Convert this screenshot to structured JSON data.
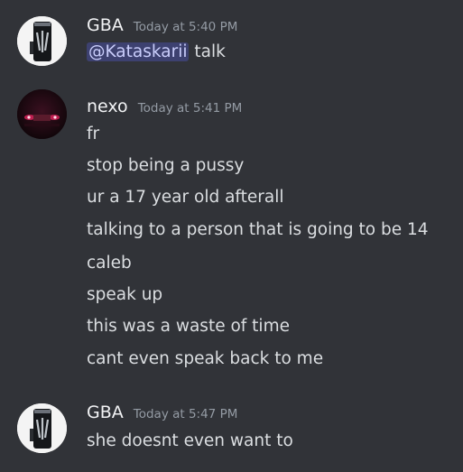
{
  "colors": {
    "background": "#313338",
    "username": "#f2f3f5",
    "timestamp": "#949ba4",
    "text": "#dbdee1",
    "mention_bg": "#3c4270",
    "mention_text": "#c9cdfb"
  },
  "messages": [
    {
      "username": "GBA",
      "timestamp": "Today at 5:40 PM",
      "avatar_icon": "monster-energy-can-icon",
      "mention": "@Kataskarii",
      "lines": [
        "talk"
      ]
    },
    {
      "username": "nexo",
      "timestamp": "Today at 5:41 PM",
      "avatar_icon": "dark-car-image-icon",
      "lines": [
        "fr",
        "stop being a pussy",
        "ur a 17 year old afterall",
        "talking to a person that is going to be 14",
        "caleb",
        "speak up",
        "this was a waste of time",
        "cant even speak back to me"
      ]
    },
    {
      "username": "GBA",
      "timestamp": "Today at 5:47 PM",
      "avatar_icon": "monster-energy-can-icon",
      "lines": [
        "she doesnt even want to"
      ]
    }
  ]
}
